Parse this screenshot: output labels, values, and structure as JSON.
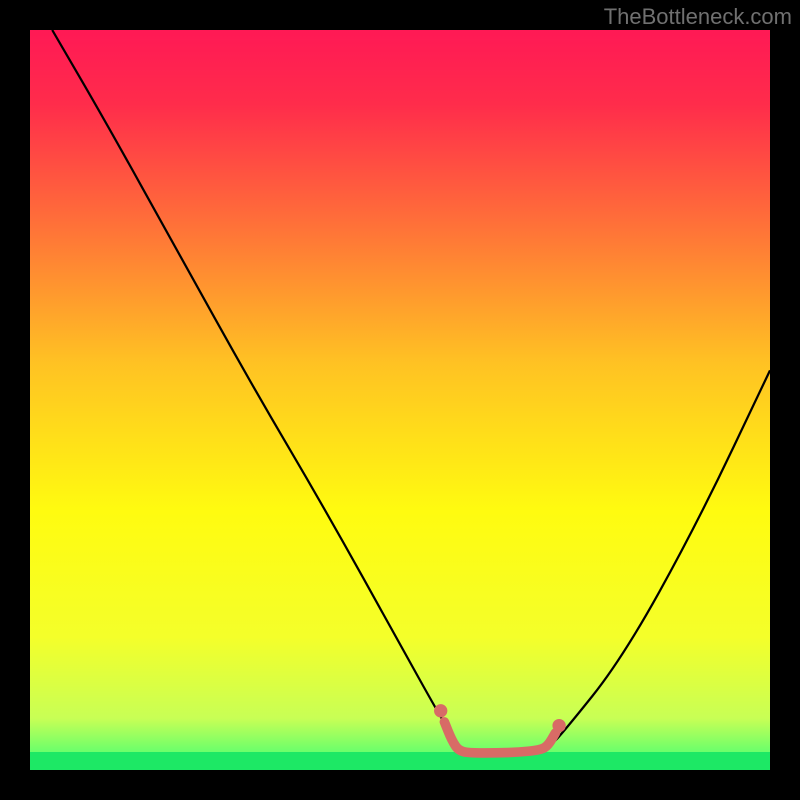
{
  "watermark": "TheBottleneck.com",
  "chart_data": {
    "type": "line",
    "title": "",
    "xlabel": "",
    "ylabel": "",
    "xlim": [
      0,
      100
    ],
    "ylim": [
      0,
      100
    ],
    "grid": false,
    "legend": "none",
    "annotations": [],
    "gradient_background": {
      "stops": [
        {
          "pos": 0.0,
          "color": "#ff1955"
        },
        {
          "pos": 0.1,
          "color": "#ff2c4b"
        },
        {
          "pos": 0.25,
          "color": "#ff6b3a"
        },
        {
          "pos": 0.45,
          "color": "#ffc223"
        },
        {
          "pos": 0.65,
          "color": "#fffb10"
        },
        {
          "pos": 0.82,
          "color": "#f4ff2a"
        },
        {
          "pos": 0.93,
          "color": "#c8ff55"
        },
        {
          "pos": 0.975,
          "color": "#6bff6b"
        },
        {
          "pos": 1.0,
          "color": "#1de865"
        }
      ]
    },
    "series": [
      {
        "name": "bottleneck-curve",
        "color": "#000000",
        "width": 2,
        "x": [
          3,
          10,
          20,
          30,
          40,
          50,
          55,
          58,
          60,
          65,
          70,
          72,
          80,
          90,
          100
        ],
        "y": [
          100,
          88,
          70,
          52,
          35,
          17,
          8,
          3,
          2,
          2,
          3,
          5,
          15,
          33,
          54
        ]
      },
      {
        "name": "optimal-zone-marker",
        "color": "#d86b66",
        "width": 9,
        "x": [
          56,
          57,
          58,
          60,
          63,
          66,
          69,
          70,
          71
        ],
        "y": [
          6.5,
          4,
          2.5,
          2.3,
          2.3,
          2.4,
          2.7,
          3.3,
          5
        ]
      },
      {
        "name": "optimal-zone-dot-left",
        "color": "#d86b66",
        "shape": "dot",
        "x": [
          55.5
        ],
        "y": [
          8
        ]
      },
      {
        "name": "optimal-zone-dot-right",
        "color": "#d86b66",
        "shape": "dot",
        "x": [
          71.5
        ],
        "y": [
          6
        ]
      }
    ]
  }
}
